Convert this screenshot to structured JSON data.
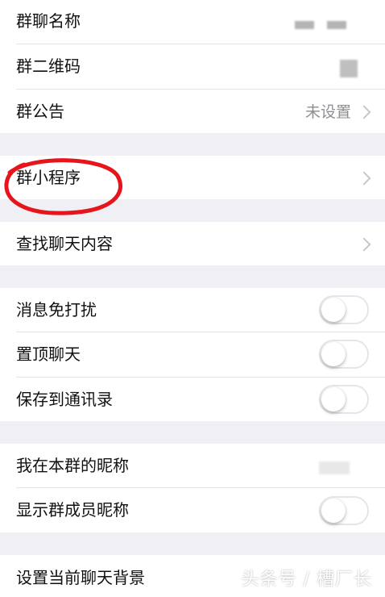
{
  "groups": [
    {
      "rows": [
        {
          "label": "群聊名称",
          "value": "",
          "accessory": "blurred-text"
        },
        {
          "label": "群二维码",
          "value": "",
          "accessory": "qr"
        },
        {
          "label": "群公告",
          "value": "未设置",
          "accessory": "chevron"
        }
      ]
    },
    {
      "rows": [
        {
          "label": "群小程序",
          "accessory": "chevron"
        }
      ]
    },
    {
      "rows": [
        {
          "label": "查找聊天内容",
          "accessory": "chevron"
        }
      ]
    },
    {
      "rows": [
        {
          "label": "消息免打扰",
          "accessory": "toggle",
          "on": false
        },
        {
          "label": "置顶聊天",
          "accessory": "toggle",
          "on": false
        },
        {
          "label": "保存到通讯录",
          "accessory": "toggle",
          "on": false
        }
      ]
    },
    {
      "rows": [
        {
          "label": "我在本群的昵称",
          "accessory": "blurred-text"
        },
        {
          "label": "显示群成员昵称",
          "accessory": "toggle",
          "on": false
        }
      ]
    },
    {
      "rows": [
        {
          "label": "设置当前聊天背景"
        }
      ]
    }
  ],
  "watermark": "头条号 / 槽厂长",
  "annotation_color": "#e8141b",
  "toggle_off_border": "#e5e5ea",
  "background": "#efeff4"
}
